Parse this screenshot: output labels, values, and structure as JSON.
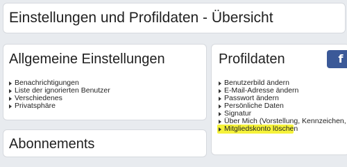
{
  "header": {
    "title": "Einstellungen und Profildaten - Übersicht"
  },
  "general_settings": {
    "title": "Allgemeine Einstellungen",
    "items": [
      {
        "label": "Benachrichtigungen"
      },
      {
        "label": "Liste der ignorierten Benutzer"
      },
      {
        "label": "Verschiedenes"
      },
      {
        "label": "Privatsphäre"
      }
    ]
  },
  "profile_data": {
    "title": "Profildaten",
    "social_button": {
      "icon": "facebook-icon",
      "glyph": "f",
      "color": "#3b5998"
    },
    "items": [
      {
        "label": "Benutzerbild ändern"
      },
      {
        "label": "E-Mail-Adresse ändern"
      },
      {
        "label": "Passwort ändern"
      },
      {
        "label": "Persönliche Daten"
      },
      {
        "label": "Signatur"
      },
      {
        "label": "Über Mich (Vorstellung, Kennzeichen, etc..."
      },
      {
        "label": "Mitgliedskonto löschen",
        "highlighted": true
      }
    ],
    "highlight_color": "#f5f23a"
  },
  "subscriptions": {
    "title": "Abonnements"
  }
}
